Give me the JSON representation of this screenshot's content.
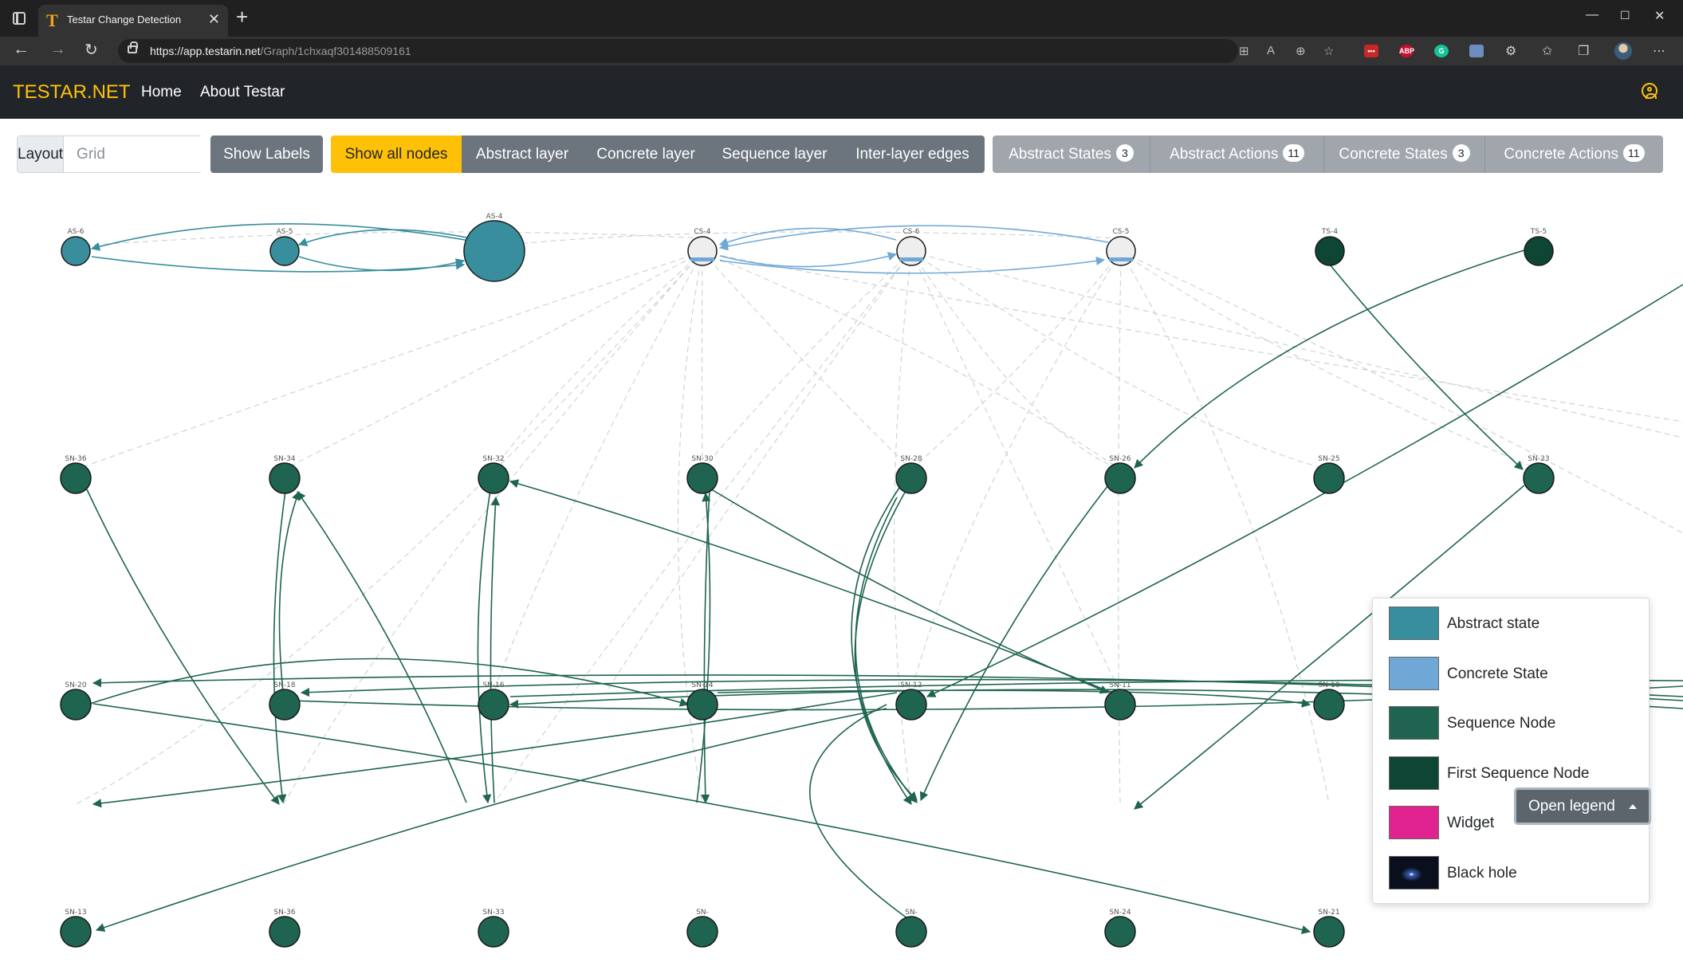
{
  "browser": {
    "tab_title": "Testar Change Detection",
    "url_host": "https://app.testarin.net",
    "url_path": "/Graph/1chxaqf301488509161"
  },
  "navbar": {
    "brand": "TESTAR.NET",
    "links": [
      "Home",
      "About Testar"
    ]
  },
  "controls": {
    "layout_label": "Layout",
    "layout_placeholder": "Grid",
    "show_labels": "Show Labels",
    "filters": [
      "Show all nodes",
      "Abstract layer",
      "Concrete layer",
      "Sequence layer",
      "Inter-layer edges"
    ],
    "counts": [
      {
        "label": "Abstract States",
        "count": "3"
      },
      {
        "label": "Abstract Actions",
        "count": "11"
      },
      {
        "label": "Concrete States",
        "count": "3"
      },
      {
        "label": "Concrete Actions",
        "count": "11"
      }
    ]
  },
  "colors": {
    "abstract_state": "#388e9c",
    "concrete_state": "#6fa8d6",
    "sequence_node": "#1e6450",
    "first_sequence_node": "#0f4535",
    "widget": "#e0238e",
    "accent": "#ffc107"
  },
  "graph": {
    "node_labels": [
      "AS-6",
      "AS-5",
      "AS-4",
      "CS-4",
      "CS-6",
      "CS-5",
      "TS-4",
      "TS-5",
      "SN-36",
      "SN-34",
      "SN-32",
      "SN-30",
      "SN-28",
      "SN-26",
      "SN-25",
      "SN-23",
      "SN-20",
      "SN-18",
      "SN-16",
      "SN-14",
      "SN-12",
      "SN-11",
      "SN-10",
      "SN-13",
      "SN-36",
      "SN-33",
      "SN-",
      "SN-",
      "SN-24",
      "SN-21"
    ]
  },
  "legend": {
    "items": [
      {
        "label": "Abstract state",
        "color": "#388e9c"
      },
      {
        "label": "Concrete State",
        "color": "#6fa8d6"
      },
      {
        "label": "Sequence Node",
        "color": "#1e6450"
      },
      {
        "label": "First Sequence Node",
        "color": "#0f4535"
      },
      {
        "label": "Widget",
        "color": "#e0238e"
      },
      {
        "label": "Black hole",
        "color": "#0a0f1e"
      }
    ],
    "button": "Open legend"
  }
}
